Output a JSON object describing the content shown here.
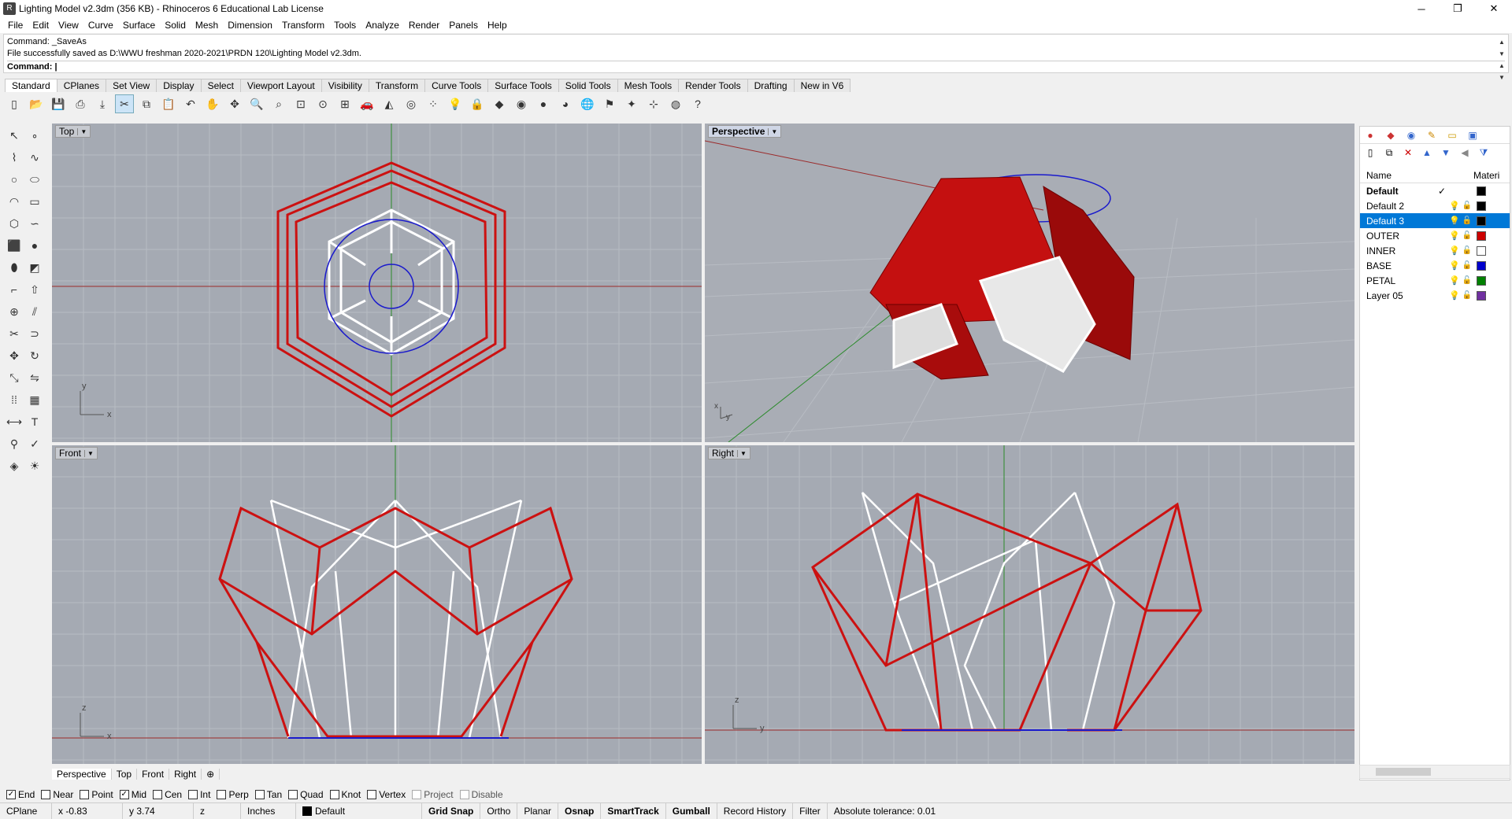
{
  "window": {
    "title": "Lighting Model v2.3dm (356 KB) - Rhinoceros 6 Educational Lab License",
    "min": "─",
    "max": "❐",
    "close": "✕"
  },
  "menu": [
    "File",
    "Edit",
    "View",
    "Curve",
    "Surface",
    "Solid",
    "Mesh",
    "Dimension",
    "Transform",
    "Tools",
    "Analyze",
    "Render",
    "Panels",
    "Help"
  ],
  "command": {
    "history1": "Command: _SaveAs",
    "history2": "File successfully saved as D:\\WWU freshman 2020-2021\\PRDN 120\\Lighting Model v2.3dm.",
    "prompt": "Command:"
  },
  "toolbar_tabs": [
    "Standard",
    "CPlanes",
    "Set View",
    "Display",
    "Select",
    "Viewport Layout",
    "Visibility",
    "Transform",
    "Curve Tools",
    "Surface Tools",
    "Solid Tools",
    "Mesh Tools",
    "Render Tools",
    "Drafting",
    "New in V6"
  ],
  "toolbar_icons": [
    "new-icon",
    "open-icon",
    "save-icon",
    "print-icon",
    "import-icon",
    "cut-icon",
    "copy-icon",
    "paste-icon",
    "undo-icon",
    "pan-icon",
    "rotate-view-icon",
    "zoom-icon",
    "zoom-window-icon",
    "zoom-extents-icon",
    "zoom-selected-icon",
    "four-viewports-icon",
    "car-icon",
    "camera-icon",
    "target-icon",
    "points-icon",
    "bulb-icon",
    "lock-icon",
    "layer-icon",
    "color-wheel-icon",
    "sphere-icon",
    "render-sphere-icon",
    "globe-icon",
    "lamp-icon",
    "flashlight-icon",
    "grid-icon",
    "web-icon",
    "help-icon"
  ],
  "viewports": {
    "top": {
      "label": "Top",
      "axis_x": "x",
      "axis_y": "y"
    },
    "perspective": {
      "label": "Perspective",
      "axis_x": "x",
      "axis_y": "y"
    },
    "front": {
      "label": "Front",
      "axis_x": "x",
      "axis_y": "z"
    },
    "right": {
      "label": "Right",
      "axis_x": "y",
      "axis_y": "z"
    }
  },
  "viewport_tabs": [
    "Perspective",
    "Top",
    "Front",
    "Right"
  ],
  "layers": {
    "header_name": "Name",
    "header_material": "Materi",
    "rows": [
      {
        "name": "Default",
        "color": "#000000",
        "current": true
      },
      {
        "name": "Default 2",
        "color": "#000000"
      },
      {
        "name": "Default 3",
        "color": "#000000",
        "selected": true
      },
      {
        "name": "OUTER",
        "color": "#cc0000"
      },
      {
        "name": "INNER",
        "color": "#ffffff"
      },
      {
        "name": "BASE",
        "color": "#0000cc"
      },
      {
        "name": "PETAL",
        "color": "#008000"
      },
      {
        "name": "Layer 05",
        "color": "#7030a0"
      }
    ]
  },
  "osnaps": [
    {
      "label": "End",
      "checked": true
    },
    {
      "label": "Near",
      "checked": false
    },
    {
      "label": "Point",
      "checked": false
    },
    {
      "label": "Mid",
      "checked": true
    },
    {
      "label": "Cen",
      "checked": false
    },
    {
      "label": "Int",
      "checked": false
    },
    {
      "label": "Perp",
      "checked": false
    },
    {
      "label": "Tan",
      "checked": false
    },
    {
      "label": "Quad",
      "checked": false
    },
    {
      "label": "Knot",
      "checked": false
    },
    {
      "label": "Vertex",
      "checked": false
    },
    {
      "label": "Project",
      "checked": false,
      "disabled": true
    },
    {
      "label": "Disable",
      "checked": false,
      "disabled": true
    }
  ],
  "status": {
    "cplane": "CPlane",
    "x": "x -0.83",
    "y": "y 3.74",
    "z": "z",
    "units": "Inches",
    "layer": "Default",
    "grid_snap": "Grid Snap",
    "ortho": "Ortho",
    "planar": "Planar",
    "osnap": "Osnap",
    "smarttrack": "SmartTrack",
    "gumball": "Gumball",
    "record_history": "Record History",
    "filter": "Filter",
    "tolerance": "Absolute tolerance: 0.01"
  },
  "colors": {
    "viewport_bg": "#a5aab3",
    "outer": "#cc1111",
    "inner": "#ffffff",
    "base": "#1a1acc",
    "selection": "#0078d7"
  }
}
